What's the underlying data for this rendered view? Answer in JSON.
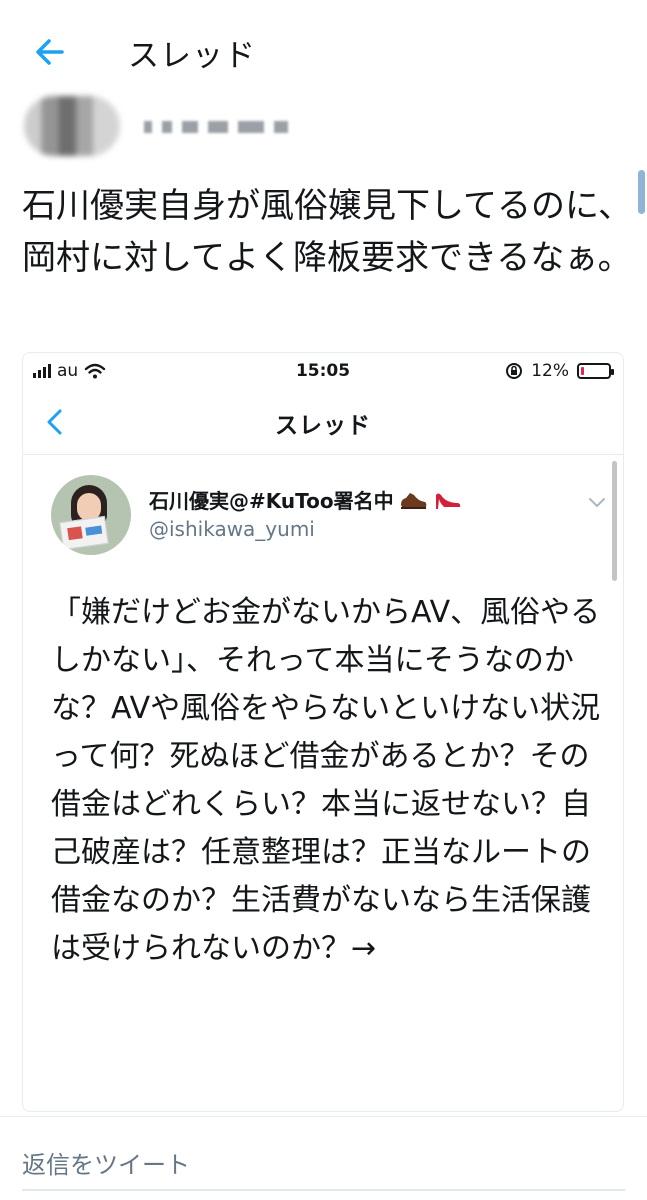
{
  "header": {
    "title": "スレッド",
    "back_icon": "arrow-left-icon",
    "accent_color": "#1da1f2"
  },
  "tweet": {
    "text": "石川優実自身が風俗嬢見下してるのに、岡村に対してよく降板要求できるなぁ。"
  },
  "embedded_screenshot": {
    "status_bar": {
      "carrier": "au",
      "time": "15:05",
      "battery_percent": "12%",
      "battery_level": 0.12
    },
    "nav_title": "スレッド",
    "author": {
      "name": "石川優実@#KuToo署名中",
      "handle": "@ishikawa_yumi"
    },
    "text": "「嫌だけどお金がないからAV、風俗やるしかない」、それって本当にそうなのかな？AVや風俗をやらないといけない状況って何？死ぬほど借金があるとか？その借金はどれくらい？本当に返せない？自己破産は？任意整理は？正当なルートの借金なのか？生活費がないなら生活保護は受けられないのか？→"
  },
  "reply": {
    "placeholder": "返信をツイート"
  }
}
